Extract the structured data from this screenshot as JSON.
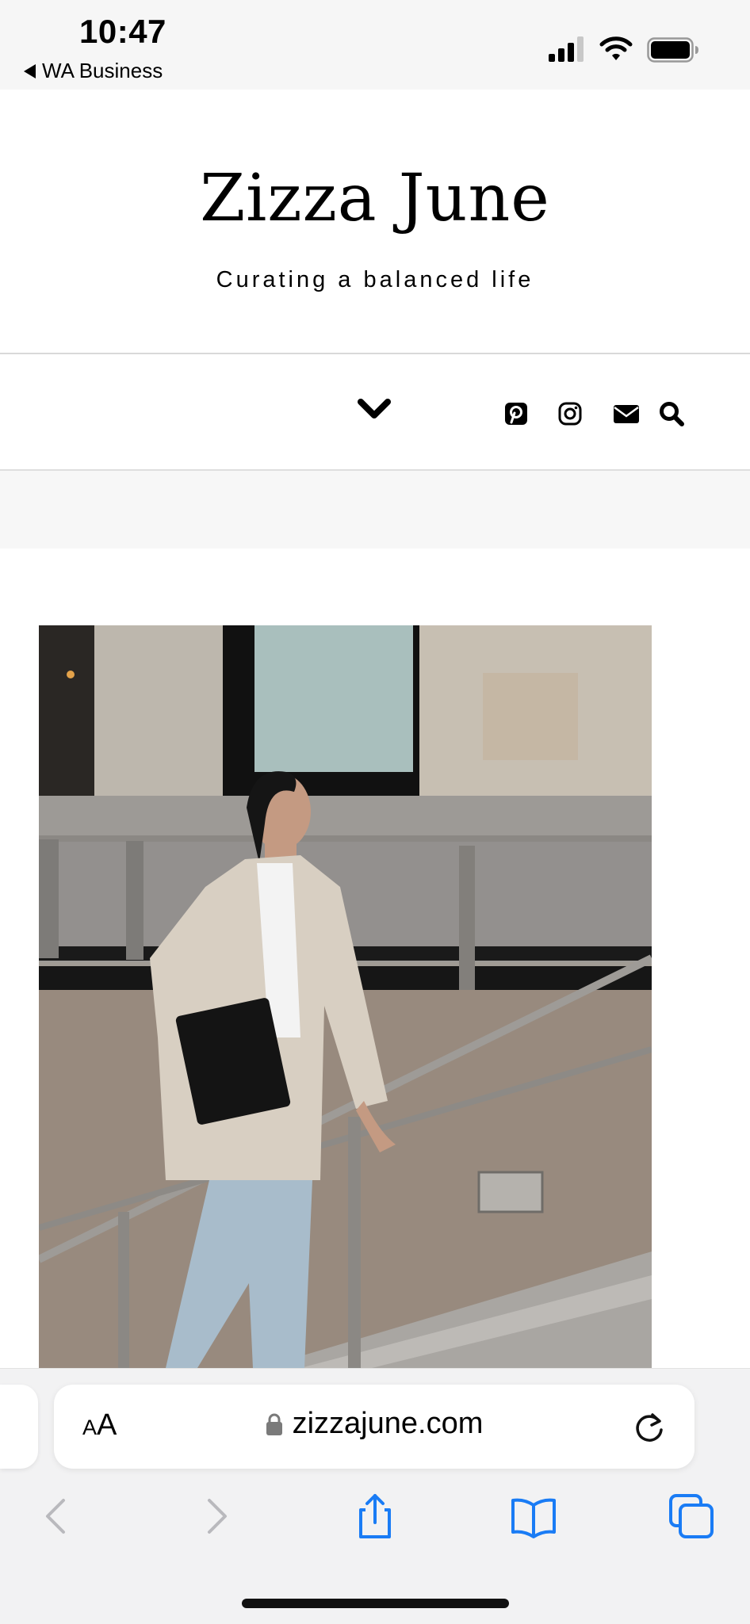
{
  "status_bar": {
    "time": "10:47",
    "back_app": "WA Business",
    "icons": [
      "signal-icon",
      "wifi-icon",
      "battery-icon"
    ]
  },
  "site": {
    "title": "Zizza June",
    "tagline": "Curating a balanced life"
  },
  "nav": {
    "toggle_icon": "chevron-down-icon",
    "social_icons": [
      "pinterest-icon",
      "instagram-icon",
      "email-icon",
      "search-icon"
    ]
  },
  "photo": {
    "subject": "woman-walking-down-stairs"
  },
  "safari": {
    "text_size_label_small": "A",
    "text_size_label_large": "A",
    "url": "zizzajune.com",
    "toolbar_icons": [
      "back-icon",
      "forward-icon",
      "share-icon",
      "bookmarks-icon",
      "tabs-icon"
    ],
    "accent_color": "#1a7cf5",
    "disabled_color": "#b9b9bd"
  }
}
